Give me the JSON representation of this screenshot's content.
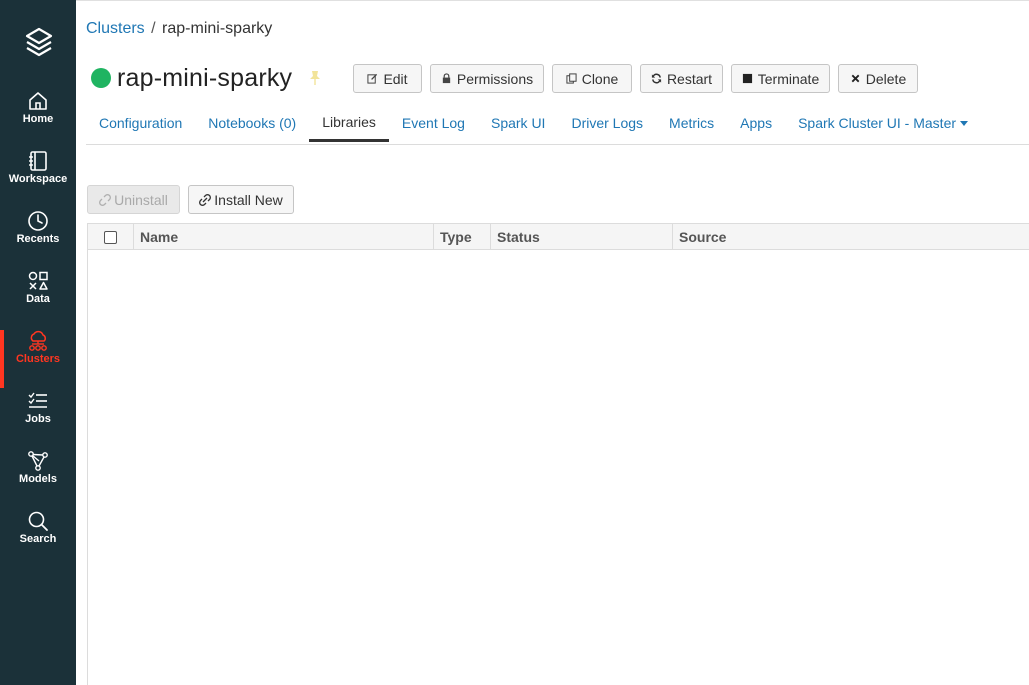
{
  "sidebar": {
    "items": [
      {
        "label": "Home"
      },
      {
        "label": "Workspace"
      },
      {
        "label": "Recents"
      },
      {
        "label": "Data"
      },
      {
        "label": "Clusters"
      },
      {
        "label": "Jobs"
      },
      {
        "label": "Models"
      },
      {
        "label": "Search"
      }
    ],
    "active_color": "#ff3621",
    "background": "#1b3139"
  },
  "breadcrumb": {
    "parent": "Clusters",
    "separator": "/",
    "current": "rap-mini-sparky"
  },
  "cluster": {
    "name": "rap-mini-sparky",
    "status_color": "#1fb461"
  },
  "actions": {
    "edit": "Edit",
    "permissions": "Permissions",
    "clone": "Clone",
    "restart": "Restart",
    "terminate": "Terminate",
    "delete": "Delete"
  },
  "tabs": [
    {
      "label": "Configuration"
    },
    {
      "label": "Notebooks (0)"
    },
    {
      "label": "Libraries"
    },
    {
      "label": "Event Log"
    },
    {
      "label": "Spark UI"
    },
    {
      "label": "Driver Logs"
    },
    {
      "label": "Metrics"
    },
    {
      "label": "Apps"
    },
    {
      "label": "Spark Cluster UI - Master"
    }
  ],
  "active_tab": "Libraries",
  "libraries": {
    "uninstall_label": "Uninstall",
    "install_label": "Install New",
    "columns": [
      "Name",
      "Type",
      "Status",
      "Source"
    ],
    "rows": []
  }
}
